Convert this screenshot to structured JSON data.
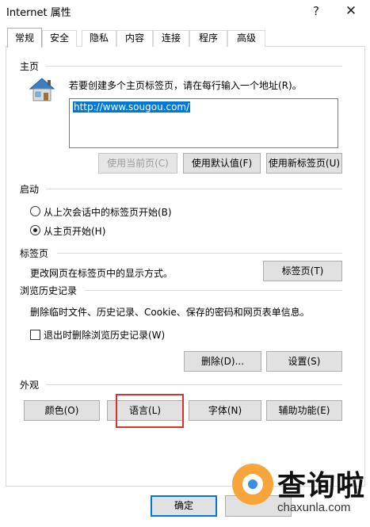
{
  "window": {
    "title": "Internet 属性",
    "help_glyph": "?",
    "close_glyph": "✕"
  },
  "tabs": [
    {
      "label": "常规",
      "active": true
    },
    {
      "label": "安全"
    },
    {
      "label": "隐私"
    },
    {
      "label": "内容"
    },
    {
      "label": "连接"
    },
    {
      "label": "程序"
    },
    {
      "label": "高级"
    }
  ],
  "home": {
    "section_label": "主页",
    "hint": "若要创建多个主页标签页，请在每行输入一个地址(R)。",
    "url_value": "http://www.sougou.com/",
    "use_current": "使用当前页(C)",
    "use_default": "使用默认值(F)",
    "use_new_tab": "使用新标签页(U)"
  },
  "startup": {
    "section_label": "启动",
    "option_last_session": "从上次会话中的标签页开始(B)",
    "option_home": "从主页开始(H)",
    "selected": "option_home"
  },
  "tabs_section": {
    "section_label": "标签页",
    "description": "更改网页在标签页中的显示方式。",
    "button": "标签页(T)"
  },
  "history": {
    "section_label": "浏览历史记录",
    "description": "删除临时文件、历史记录、Cookie、保存的密码和网页表单信息。",
    "checkbox_label": "退出时删除浏览历史记录(W)",
    "checkbox_checked": false,
    "delete_button": "删除(D)...",
    "settings_button": "设置(S)"
  },
  "appearance": {
    "section_label": "外观",
    "colors_button": "颜色(O)",
    "languages_button": "语言(L)",
    "fonts_button": "字体(N)",
    "accessibility_button": "辅助功能(E)"
  },
  "footer": {
    "ok_button": "确定"
  },
  "watermark": {
    "text": "查询啦",
    "url": "chaxunla.com"
  },
  "colors": {
    "selection": "#0078d7",
    "highlight_box": "#d9312e",
    "watermark_orange": "#f5a53a",
    "watermark_blue": "#3a8ee6"
  }
}
